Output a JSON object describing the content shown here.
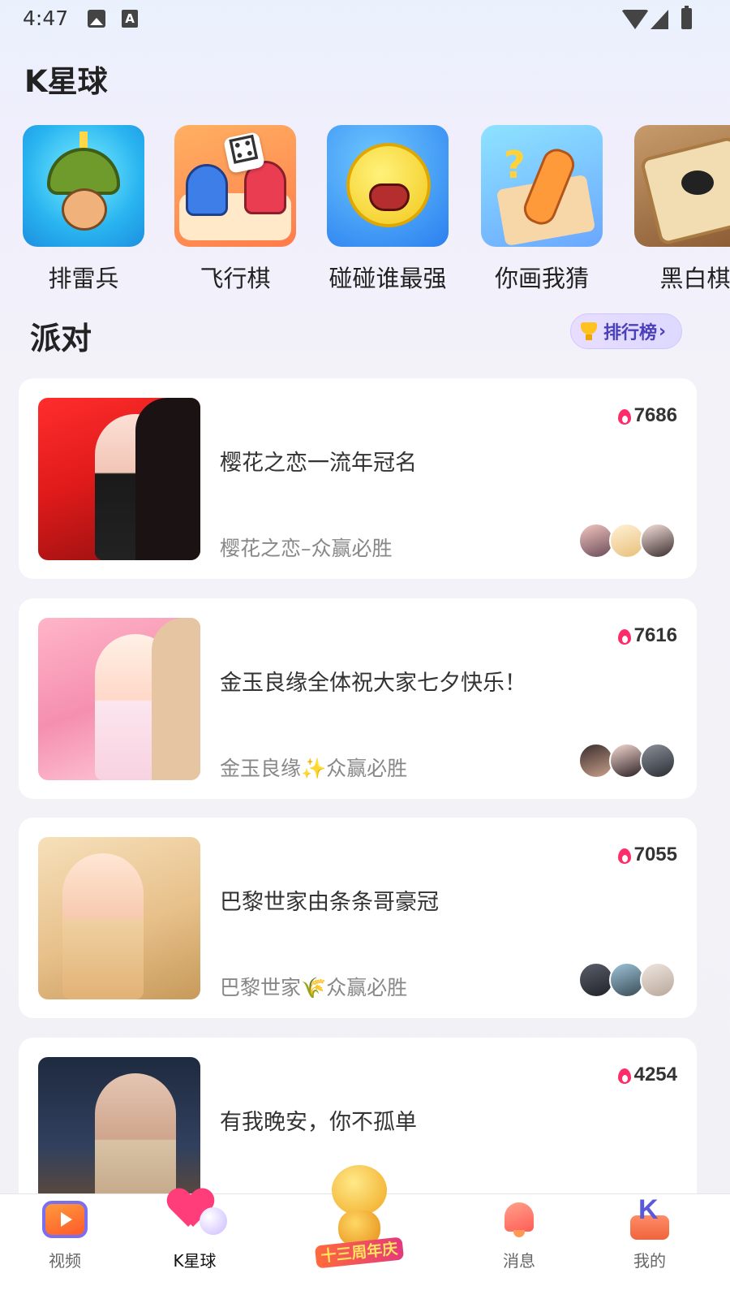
{
  "status_bar": {
    "time": "4:47",
    "a_indicator": "A"
  },
  "page": {
    "title": "K星球"
  },
  "games": [
    {
      "label": "排雷兵",
      "icon": "minesweeper-soldier"
    },
    {
      "label": "飞行棋",
      "icon": "ludo-dice"
    },
    {
      "label": "碰碰谁最强",
      "icon": "bump-blob"
    },
    {
      "label": "你画我猜",
      "icon": "draw-guess-pencil"
    },
    {
      "label": "黑白棋",
      "icon": "reversi-board"
    }
  ],
  "party": {
    "section_title": "派对",
    "rank_button": {
      "label": "排行榜",
      "chevron": "›"
    }
  },
  "rooms": [
    {
      "hot": "7686",
      "title": "樱花之恋一流年冠名",
      "subtitle": "樱花之恋–众赢必胜"
    },
    {
      "hot": "7616",
      "title": "金玉良缘全体祝大家七夕快乐！",
      "subtitle": "金玉良缘✨众赢必胜"
    },
    {
      "hot": "7055",
      "title": "巴黎世家由条条哥豪冠",
      "subtitle": "巴黎世家🌾众赢必胜"
    },
    {
      "hot": "4254",
      "title": "有我晚安，你不孤单",
      "subtitle": ""
    }
  ],
  "bottom_nav": {
    "video": "视频",
    "planet": "K星球",
    "anniversary_badge": "十三周年庆",
    "messages": "消息",
    "me": "我的"
  },
  "colors": {
    "accent_hot": "#ff2c6c",
    "rank_text": "#4a40b8",
    "rank_bg": "#e8ddff"
  }
}
